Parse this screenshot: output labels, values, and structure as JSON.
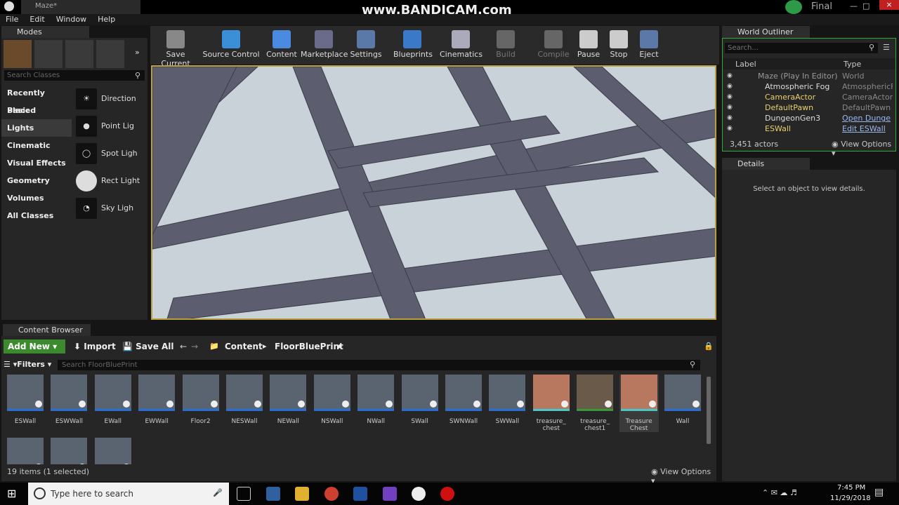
{
  "window": {
    "title": "Maze*",
    "watermark": "www.BANDICAM.com",
    "right_label": "Final"
  },
  "menu": [
    "File",
    "Edit",
    "Window",
    "Help"
  ],
  "modes": {
    "tab": "Modes",
    "search_placeholder": "Search Classes",
    "categories": [
      "Recently Placed",
      "Basic",
      "Lights",
      "Cinematic",
      "Visual Effects",
      "Geometry",
      "Volumes",
      "All Classes"
    ],
    "items": [
      "Direction",
      "Point Lig",
      "Spot Ligh",
      "Rect Light",
      "Sky Ligh"
    ]
  },
  "toolbar": [
    "Save Current",
    "Source Control",
    "Content",
    "Marketplace",
    "Settings",
    "Blueprints",
    "Cinematics",
    "Build",
    "Compile",
    "Pause",
    "Stop",
    "Eject"
  ],
  "outliner": {
    "tab": "World Outliner",
    "search_placeholder": "Search...",
    "col_label": "Label",
    "col_type": "Type",
    "rows": [
      {
        "label": "Maze (Play In Editor)",
        "type": "World"
      },
      {
        "label": "Atmospheric Fog",
        "type": "AtmosphericF"
      },
      {
        "label": "CameraActor",
        "type": "CameraActor"
      },
      {
        "label": "DefaultPawn",
        "type": "DefaultPawn"
      },
      {
        "label": "DungeonGen3",
        "type": "Open Dunge"
      },
      {
        "label": "ESWall",
        "type": "Edit ESWall"
      }
    ],
    "count": "3,451 actors",
    "view_options": "View Options"
  },
  "details": {
    "tab": "Details",
    "message": "Select an object to view details."
  },
  "content": {
    "tab": "Content Browser",
    "add_new": "Add New",
    "import": "Import",
    "save_all": "Save All",
    "path": [
      "Content",
      "FloorBluePrint"
    ],
    "filters": "Filters",
    "search_placeholder": "Search FloorBluePrint",
    "assets": [
      "ESWall",
      "ESWWall",
      "EWall",
      "EWWall",
      "Floor2",
      "NESWall",
      "NEWall",
      "NSWall",
      "NWall",
      "SWall",
      "SWNWall",
      "SWWall",
      "treasure_\nchest",
      "treasure_\nchest1",
      "Treasure\nChest",
      "Wall"
    ],
    "status": "19 items (1 selected)",
    "view_options": "View Options"
  },
  "taskbar": {
    "search": "Type here to search",
    "time": "7:45 PM",
    "date": "11/29/2018"
  }
}
